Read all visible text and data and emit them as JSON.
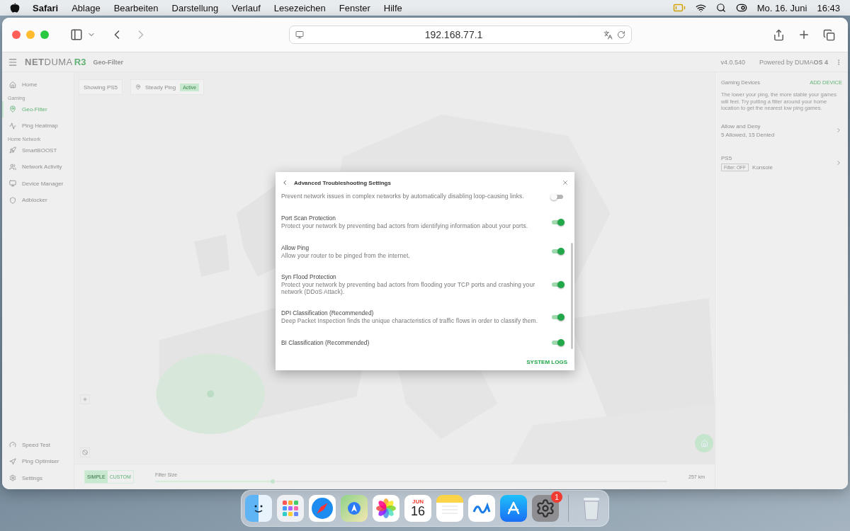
{
  "menu_bar": {
    "app": "Safari",
    "menus": [
      "Ablage",
      "Bearbeiten",
      "Darstellung",
      "Verlauf",
      "Lesezeichen",
      "Fenster",
      "Hilfe"
    ],
    "date": "Mo. 16. Juni",
    "time": "16:43"
  },
  "browser": {
    "address": "192.168.77.1"
  },
  "app": {
    "logo": "**NET**DUMA",
    "logo_model": "R3",
    "page_title": "Geo-Filter",
    "version": "v4.0.540",
    "powered_by": "Powered by DUMA**OS 4**",
    "sidebar": {
      "items": [
        {
          "kind": "item",
          "label": "Home",
          "selected": false
        },
        {
          "kind": "section",
          "label": "Gaming"
        },
        {
          "kind": "item",
          "label": "Geo-Filter",
          "selected": true
        },
        {
          "kind": "item",
          "label": "Ping Heatmap",
          "selected": false
        },
        {
          "kind": "section",
          "label": "Home Network"
        },
        {
          "kind": "item",
          "label": "SmartBOOST",
          "selected": false
        },
        {
          "kind": "item",
          "label": "Network Activity",
          "selected": false
        },
        {
          "kind": "item",
          "label": "Device Manager",
          "selected": false
        },
        {
          "kind": "item",
          "label": "Adblocker",
          "selected": false
        }
      ],
      "footer_items": [
        {
          "label": "Speed Test",
          "selected": false
        },
        {
          "label": "Ping Optimiser",
          "selected": false
        },
        {
          "label": "Settings",
          "selected": false
        }
      ]
    },
    "map_toolbar": {
      "device": "Showing PS5",
      "mode": "Steady Ping",
      "mode_badge": "Active"
    },
    "bottom_bar": {
      "modes": [
        {
          "label": "SIMPLE",
          "selected": true
        },
        {
          "label": "CUSTOM",
          "selected": false
        }
      ],
      "slider_label": "Filter Size",
      "slider": {
        "level": 0.23
      },
      "slider_value": "257 km"
    },
    "right_panel": {
      "title": "Gaming Devices",
      "action": "ADD DEVICE",
      "description": "The lower your ping, the more stable your games will feel. Try putting a filter around your home location to get the nearest low ping games.",
      "rows": [
        {
          "title": "Allow and Deny",
          "subtitle": "5 Allowed, 15 Denied"
        },
        {
          "title": "PS5",
          "tag": "Filter: OFF",
          "subtitle": "Konsole"
        }
      ]
    }
  },
  "modal": {
    "title": "Advanced Troubleshooting Settings",
    "items": [
      {
        "description": "Prevent network issues in complex networks by automatically disabling loop-causing links.",
        "on": false
      },
      {
        "title": "Port Scan Protection",
        "description": "Protect your network by preventing bad actors from identifying information about your ports.",
        "on": true
      },
      {
        "title": "Allow Ping",
        "description": "Allow your router to be pinged from the internet.",
        "on": true
      },
      {
        "title": "Syn Flood Protection",
        "description": "Protect your network by preventing bad actors from flooding your TCP ports and crashing your network (DDoS Attack).",
        "on": true
      },
      {
        "title": "DPI Classification (Recommended)",
        "description": "Deep Packet Inspection finds the unique characteristics of traffic flows in order to classify them.",
        "on": true
      },
      {
        "title": "BI Classification (Recommended)",
        "on": true
      }
    ],
    "footer_action": "SYSTEM LOGS"
  },
  "dock": {
    "items": [
      {
        "kind": "finder"
      },
      {
        "kind": "launchpad"
      },
      {
        "kind": "safari"
      },
      {
        "kind": "maps"
      },
      {
        "kind": "photos"
      },
      {
        "kind": "calendar",
        "month": "JUN",
        "day": "16"
      },
      {
        "kind": "notes"
      },
      {
        "kind": "freeform"
      },
      {
        "kind": "appstore"
      },
      {
        "kind": "settings",
        "badge": "1"
      },
      {
        "kind": "separator"
      },
      {
        "kind": "trash"
      }
    ]
  }
}
